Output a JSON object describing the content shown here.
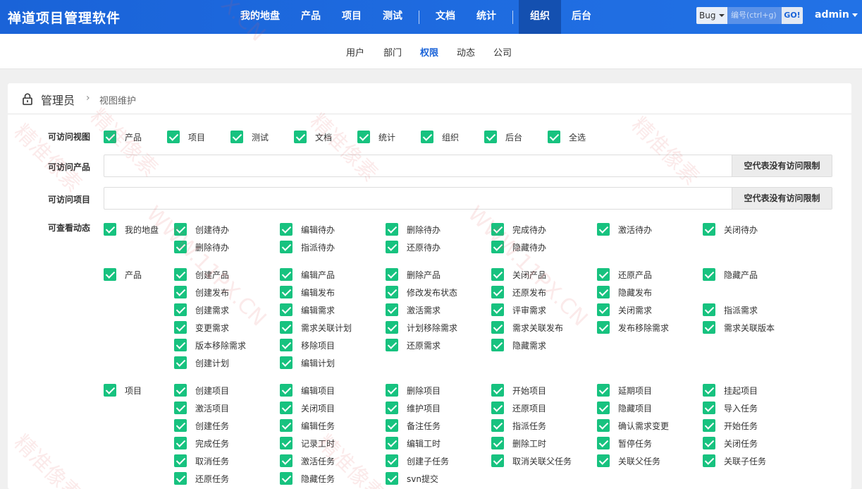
{
  "header": {
    "brand": "禅道项目管理软件",
    "nav": [
      "我的地盘",
      "产品",
      "项目",
      "测试",
      "文档",
      "统计",
      "组织",
      "后台"
    ],
    "search_type": "Bug",
    "search_placeholder": "编号(ctrl+g)",
    "search_go": "GO!",
    "user": "admin"
  },
  "subnav": [
    "用户",
    "部门",
    "权限",
    "动态",
    "公司"
  ],
  "breadcrumb": {
    "root": "管理员",
    "sep": "›",
    "current": "视图维护"
  },
  "form": {
    "views_label": "可访问视图",
    "views": [
      "产品",
      "项目",
      "测试",
      "文档",
      "统计",
      "组织",
      "后台",
      "全选"
    ],
    "products_label": "可访问产品",
    "projects_label": "可访问项目",
    "empty_hint": "空代表没有访问限制",
    "actions_label": "可查看动态",
    "groups": [
      {
        "name": "我的地盘",
        "rows": [
          [
            "创建待办",
            "编辑待办",
            "删除待办",
            "完成待办",
            "激活待办",
            "关闭待办"
          ],
          [
            "删除待办",
            "指派待办",
            "还原待办",
            "隐藏待办"
          ]
        ]
      },
      {
        "name": "产品",
        "rows": [
          [
            "创建产品",
            "编辑产品",
            "删除产品",
            "关闭产品",
            "还原产品",
            "隐藏产品"
          ],
          [
            "创建发布",
            "编辑发布",
            "修改发布状态",
            "还原发布",
            "隐藏发布"
          ],
          [
            "创建需求",
            "编辑需求",
            "激活需求",
            "评审需求",
            "关闭需求",
            "指派需求"
          ],
          [
            "变更需求",
            "需求关联计划",
            "计划移除需求",
            "需求关联发布",
            "发布移除需求",
            "需求关联版本"
          ],
          [
            "版本移除需求",
            "移除项目",
            "还原需求",
            "隐藏需求"
          ],
          [
            "创建计划",
            "编辑计划"
          ]
        ]
      },
      {
        "name": "项目",
        "rows": [
          [
            "创建项目",
            "编辑项目",
            "删除项目",
            "开始项目",
            "延期项目",
            "挂起项目"
          ],
          [
            "激活项目",
            "关闭项目",
            "维护项目",
            "还原项目",
            "隐藏项目",
            "导入任务"
          ],
          [
            "创建任务",
            "编辑任务",
            "备注任务",
            "指派任务",
            "确认需求变更",
            "开始任务"
          ],
          [
            "完成任务",
            "记录工时",
            "编辑工时",
            "删除工时",
            "暂停任务",
            "关闭任务"
          ],
          [
            "取消任务",
            "激活任务",
            "创建子任务",
            "取消关联父任务",
            "关联父任务",
            "关联子任务"
          ],
          [
            "还原任务",
            "隐藏任务",
            "svn提交"
          ]
        ]
      }
    ]
  },
  "watermarks": [
    "精准像素",
    "精准像素",
    "精准像素",
    "精准像素",
    "精准像素",
    "精准像素",
    "WWW.11PX.CN",
    "WWW.11PX.CN",
    "11PX.CN"
  ],
  "colors": {
    "brand": "#1a63d8",
    "check": "#17c27f",
    "active_nav": "#1450b0"
  }
}
